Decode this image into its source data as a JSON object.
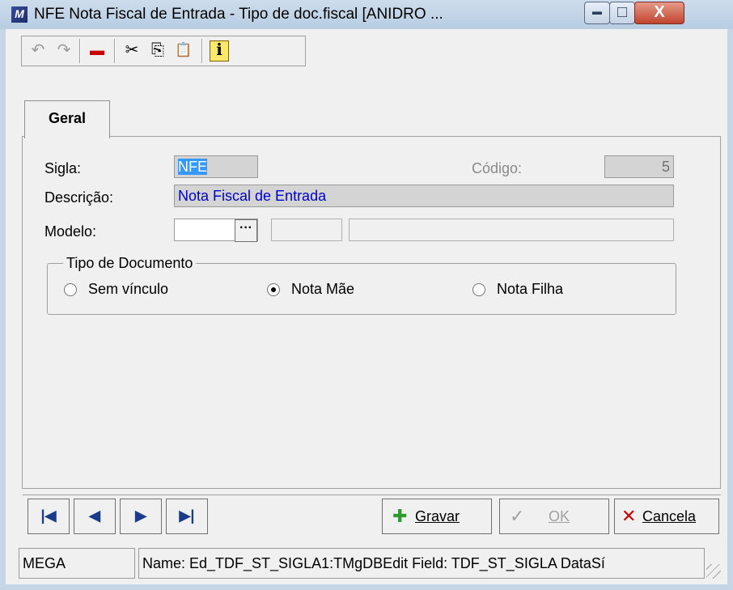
{
  "window": {
    "title": "NFE Nota Fiscal de Entrada -  Tipo de doc.fiscal [ANIDRO ...",
    "app_icon": "M",
    "controls": {
      "minimize": "▬",
      "maximize": "□",
      "close": "X"
    }
  },
  "toolbar": {
    "items": [
      {
        "name": "undo-icon",
        "glyph": "↶"
      },
      {
        "name": "redo-icon",
        "glyph": "↷"
      },
      {
        "name": "delete-record-icon",
        "glyph": "▬"
      },
      {
        "name": "cut-icon",
        "glyph": "✂"
      },
      {
        "name": "copy-icon",
        "glyph": "⎘"
      },
      {
        "name": "paste-icon",
        "glyph": "📋"
      },
      {
        "name": "info-icon",
        "glyph": "ℹ"
      }
    ]
  },
  "tabs": {
    "geral": "Geral"
  },
  "form": {
    "sigla_label": "Sigla:",
    "sigla_value": "NFE",
    "codigo_label": "Código:",
    "codigo_value": "5",
    "descricao_label": "Descrição:",
    "descricao_value": "Nota Fiscal de Entrada",
    "modelo_label": "Modelo:",
    "modelo_value": "",
    "modelo_button": "···",
    "modelo_code": "",
    "modelo_desc": ""
  },
  "tipo_documento": {
    "title": "Tipo de Documento",
    "options": [
      {
        "label": "Sem vínculo",
        "selected": false
      },
      {
        "label": "Nota Mãe",
        "selected": true
      },
      {
        "label": "Nota Filha",
        "selected": false
      }
    ]
  },
  "navigation": {
    "first": "|◀",
    "prev": "◀",
    "next": "▶",
    "last": "▶|"
  },
  "buttons": {
    "gravar": "Gravar",
    "ok": "OK",
    "cancela": "Cancela"
  },
  "status": {
    "user": "MEGA",
    "info": "Name: Ed_TDF_ST_SIGLA1:TMgDBEdit Field: TDF_ST_SIGLA DataSí"
  },
  "colors": {
    "selection": "#3399ff",
    "field_text": "#0000cc",
    "accent_red": "#e0202a",
    "gravar_icon": "#2e9b2e",
    "cancel_icon": "#cc0000"
  }
}
